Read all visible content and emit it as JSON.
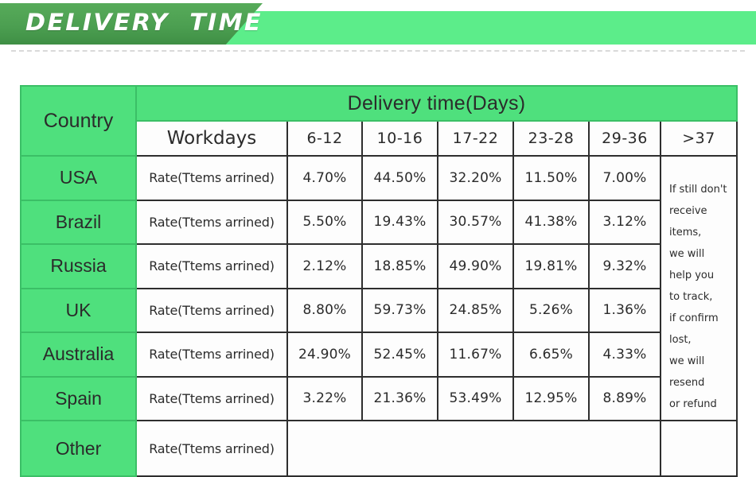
{
  "banner": {
    "title": "DELIVERY  TIME",
    "dark_green": "#4c9f51",
    "light_green": "#5ced8a"
  },
  "table": {
    "accent_green": "#4fe07d",
    "country_header": "Country",
    "group_header": "Delivery time(Days)",
    "workdays_header": "Workdays",
    "day_ranges": [
      "6-12",
      "10-16",
      "17-22",
      "23-28",
      "29-36",
      ">37"
    ],
    "rate_label": "Rate(Ttems arrined)",
    "rows": [
      {
        "country": "USA",
        "rate_label": "Rate(Ttems arrined)",
        "values": [
          "4.70%",
          "44.50%",
          "32.20%",
          "11.50%",
          "7.00%"
        ]
      },
      {
        "country": "Brazil",
        "rate_label": "Rate(Ttems arrined)",
        "values": [
          "5.50%",
          "19.43%",
          "30.57%",
          "41.38%",
          "3.12%"
        ]
      },
      {
        "country": "Russia",
        "rate_label": "Rate(Ttems arrined)",
        "values": [
          "2.12%",
          "18.85%",
          "49.90%",
          "19.81%",
          "9.32%"
        ]
      },
      {
        "country": "UK",
        "rate_label": "Rate(Ttems arrined)",
        "values": [
          "8.80%",
          "59.73%",
          "24.85%",
          "5.26%",
          "1.36%"
        ]
      },
      {
        "country": "Australia",
        "rate_label": "Rate(Ttems arrined)",
        "values": [
          "24.90%",
          "52.45%",
          "11.67%",
          "6.65%",
          "4.33%"
        ]
      },
      {
        "country": "Spain",
        "rate_label": "Rate(Ttems arrined)",
        "values": [
          "3.22%",
          "21.36%",
          "53.49%",
          "12.95%",
          "8.89%"
        ]
      }
    ],
    "other_row": {
      "country": "Other",
      "rate_label": "Rate(Ttems arrined)",
      "values_blank": "",
      "note_blank": ""
    },
    "note": "If still don't\nreceive items,\nwe will help you\nto track,\nif confirm lost,\nwe will resend\nor refund"
  }
}
